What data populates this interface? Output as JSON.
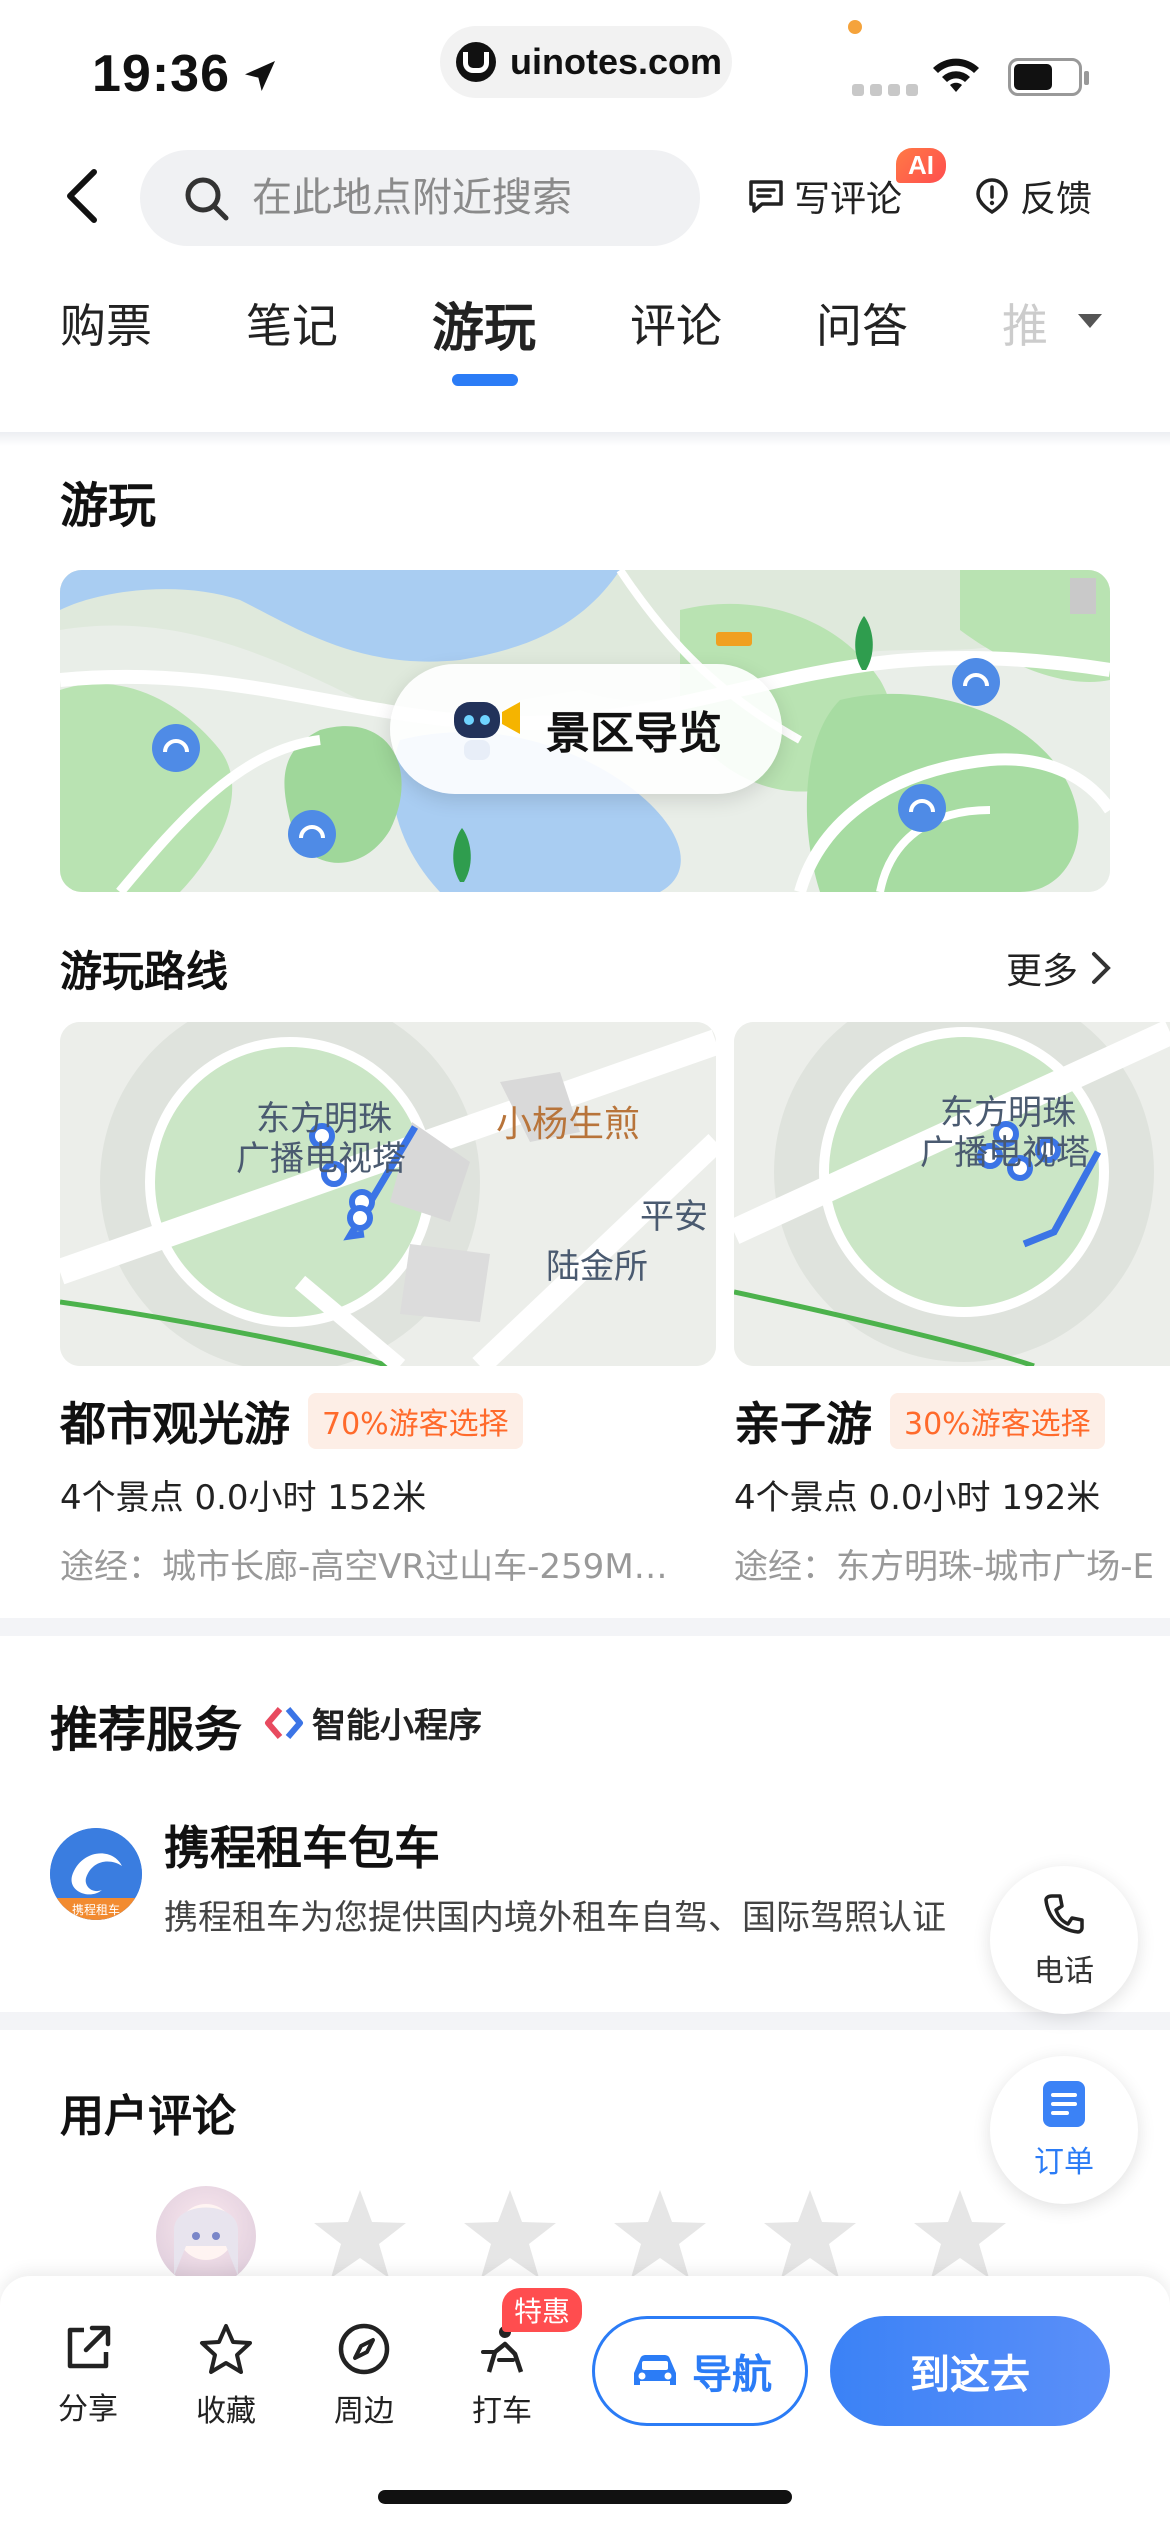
{
  "status_bar": {
    "time": "19:36",
    "url": "uinotes.com"
  },
  "header": {
    "search_placeholder": "在此地点附近搜索",
    "write_review": "写评论",
    "ai_badge": "AI",
    "feedback": "反馈"
  },
  "tabs": [
    {
      "label": "购票"
    },
    {
      "label": "笔记"
    },
    {
      "label": "游玩",
      "active": true
    },
    {
      "label": "评论"
    },
    {
      "label": "问答"
    },
    {
      "label": "推"
    }
  ],
  "play_section": {
    "title": "游玩",
    "guide_label": "景区导览"
  },
  "routes_section": {
    "title": "游玩路线",
    "more": "更多",
    "routes": [
      {
        "map_labels": [
          "东方明珠",
          "广播电视塔",
          "小杨生煎",
          "平安",
          "陆金所"
        ],
        "title": "都市观光游",
        "badge": "70%游客选择",
        "stats": "4个景点 0.0小时 152米",
        "via": "途经：城市长廊-高空VR过山车-259M…"
      },
      {
        "map_labels": [
          "东方明珠",
          "广播电视塔"
        ],
        "title": "亲子游",
        "badge": "30%游客选择",
        "stats": "4个景点 0.0小时 192米",
        "via": "途经：东方明珠-城市广场-E"
      }
    ]
  },
  "service_section": {
    "title": "推荐服务",
    "mini_program": "智能小程序",
    "service_title": "携程租车包车",
    "service_desc": "携程租车为您提供国内境外租车自驾、国际驾照认证",
    "logo_text": "携程租车"
  },
  "floating": {
    "phone": "电话",
    "order": "订单"
  },
  "reviews_section": {
    "title": "用户评论",
    "star_count": 5
  },
  "bottom_bar": {
    "share": "分享",
    "favorite": "收藏",
    "nearby": "周边",
    "taxi": "打车",
    "promo": "特惠",
    "navigate": "导航",
    "go_here": "到这去"
  },
  "colors": {
    "accent": "#2b7cf6",
    "orange": "#ff6a2b",
    "badge_red": "#ff4d4f"
  }
}
